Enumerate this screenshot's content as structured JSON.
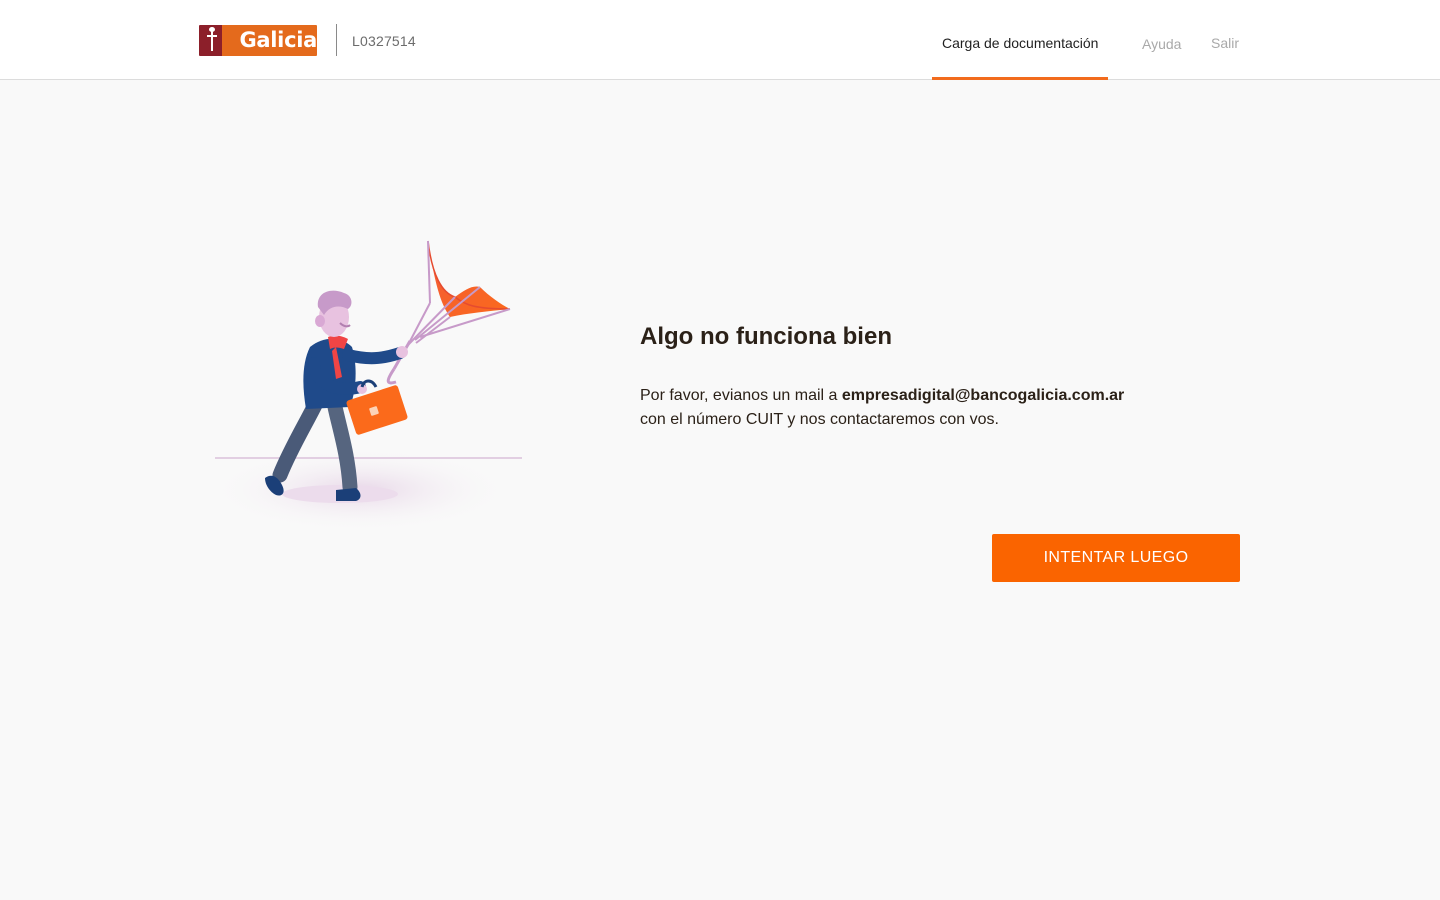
{
  "header": {
    "logo_text": "Galicia",
    "user_code": "L0327514",
    "nav": {
      "active_tab": "Carga de documentación",
      "help": "Ayuda",
      "exit": "Salir"
    }
  },
  "illustration": {
    "icon": "man-with-broken-umbrella-illustration"
  },
  "message": {
    "title": "Algo no funciona bien",
    "line1_prefix": "Por favor, evianos un mail a ",
    "email": "empresadigital@bancogalicia.com.ar",
    "line2": "con el número CUIT y nos contactaremos con vos."
  },
  "actions": {
    "retry_label": "INTENTAR LUEGO"
  },
  "colors": {
    "brand_orange": "#fa6400",
    "brand_red": "#8c1f2a",
    "background": "#f9f9f9"
  }
}
